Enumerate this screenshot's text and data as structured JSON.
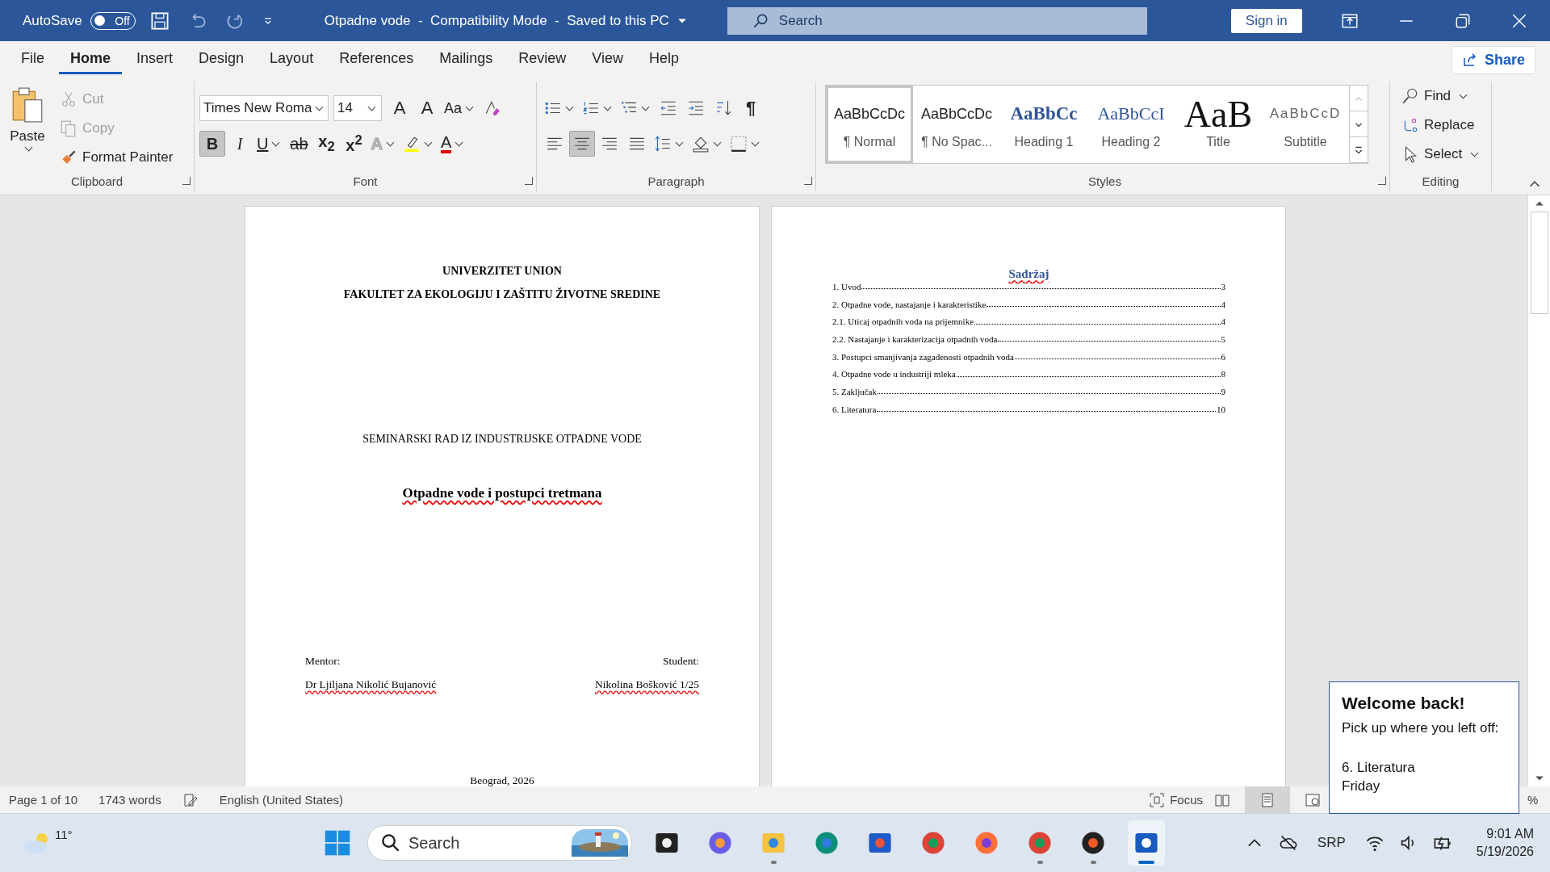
{
  "window": {
    "autosave_label": "AutoSave",
    "autosave": {
      "on": false,
      "label": "Off"
    },
    "title": "Otpadne vode  -  Compatibility Mode  -  Saved to this PC",
    "search_placeholder": "Search",
    "sign_in": "Sign in"
  },
  "menu_tabs": [
    {
      "label": "File",
      "selected": false
    },
    {
      "label": "Home",
      "selected": true
    },
    {
      "label": "Insert",
      "selected": false
    },
    {
      "label": "Design",
      "selected": false
    },
    {
      "label": "Layout",
      "selected": false
    },
    {
      "label": "References",
      "selected": false
    },
    {
      "label": "Mailings",
      "selected": false
    },
    {
      "label": "Review",
      "selected": false
    },
    {
      "label": "View",
      "selected": false
    },
    {
      "label": "Help",
      "selected": false
    }
  ],
  "share": "Share",
  "clipboard": {
    "title": "Clipboard",
    "paste": "Paste",
    "items": [
      {
        "kind": "cut",
        "label": "Cut",
        "disabled": true
      },
      {
        "kind": "copy",
        "label": "Copy",
        "disabled": true
      },
      {
        "kind": "painter",
        "label": "Format Painter",
        "disabled": false
      }
    ]
  },
  "font": {
    "title": "Font",
    "name": "Times New Roma",
    "size": "14",
    "row1": [
      {
        "kind": "grow",
        "label": "A"
      },
      {
        "kind": "shrink",
        "label": "A"
      },
      {
        "kind": "case",
        "label": "Aa"
      },
      {
        "kind": "clear"
      }
    ],
    "row2": [
      {
        "kind": "bold",
        "label": "B",
        "selected": true
      },
      {
        "kind": "italic",
        "label": "I",
        "selected": false
      },
      {
        "kind": "underline",
        "label": "U",
        "selected": false
      },
      {
        "kind": "strike",
        "label": "ab",
        "selected": false
      },
      {
        "kind": "sub",
        "label": "x$_{2}$",
        "selected": false
      },
      {
        "kind": "sup",
        "label": "x$^{2}$",
        "selected": false
      },
      {
        "kind": "effects",
        "label": "A",
        "selected": false
      },
      {
        "kind": "highlight",
        "selected": false
      },
      {
        "kind": "color",
        "label": "A",
        "selected": false
      }
    ]
  },
  "paragraph": {
    "title": "Paragraph",
    "row1": [
      {
        "kind": "bullets",
        "selected": false
      },
      {
        "kind": "numbering",
        "selected": false
      },
      {
        "kind": "multilevel",
        "selected": false
      },
      {
        "kind": "outdent",
        "selected": false
      },
      {
        "kind": "indent",
        "selected": false
      },
      {
        "kind": "sort",
        "selected": false
      },
      {
        "kind": "marks",
        "label": "¶",
        "selected": false
      }
    ],
    "row2": [
      {
        "kind": "align-left",
        "selected": false
      },
      {
        "kind": "align-center",
        "selected": true
      },
      {
        "kind": "align-right",
        "selected": false
      },
      {
        "kind": "justify",
        "selected": false
      },
      {
        "kind": "spacing",
        "selected": false
      },
      {
        "kind": "shading",
        "selected": false
      },
      {
        "kind": "borders",
        "selected": false
      }
    ]
  },
  "styles": {
    "title": "Styles",
    "items": [
      {
        "kind": "normal",
        "preview": "AaBbCcDc",
        "name": "¶ Normal",
        "selected": true
      },
      {
        "kind": "nospacing",
        "preview": "AaBbCcDc",
        "name": "¶ No Spac...",
        "selected": false
      },
      {
        "kind": "heading1",
        "preview": "AaBbCc",
        "name": "Heading 1",
        "selected": false
      },
      {
        "kind": "heading2",
        "preview": "AaBbCcI",
        "name": "Heading 2",
        "selected": false
      },
      {
        "kind": "title",
        "preview": "AaB",
        "name": "Title",
        "selected": false
      },
      {
        "kind": "subtitle",
        "preview": "AaBbCcD",
        "name": "Subtitle",
        "selected": false
      }
    ]
  },
  "editing": {
    "title": "Editing",
    "items": [
      {
        "kind": "find",
        "label": "Find"
      },
      {
        "kind": "replace",
        "label": "Replace"
      },
      {
        "kind": "select",
        "label": "Select"
      }
    ]
  },
  "page1": {
    "header": [
      "UNIVERZITET UNION",
      "FAKULTET ZA EKOLOGIJU I ZAŠTITU ŽIVOTNE SREDINE"
    ],
    "subject": "SEMINARSKI RAD IZ INDUSTRIJSKE OTPADNE VODE",
    "title": "Otpadne vode i postupci tretmana",
    "left_label": "Mentor:",
    "right_label": "Student:",
    "left_name": "Dr Ljiljana Nikolić Bujanović",
    "right_name": "Nikolina Bošković 1/25",
    "footer": "Beograd, 2026"
  },
  "page2": {
    "toc_title": "Sadržaj",
    "toc": [
      {
        "text": "1. Uvod",
        "page": "3"
      },
      {
        "text": "2. Otpadne vode, nastajanje i karakteristike",
        "page": "4"
      },
      {
        "text": "2.1. Uticaj otpadnih voda na prijemnike",
        "page": "4"
      },
      {
        "text": "2.2. Nastajanje i karakterizacija otpadnih voda",
        "page": "5"
      },
      {
        "text": "3. Postupci smanjivanja zagađenosti otpadnih voda",
        "page": "6"
      },
      {
        "text": "4. Otpadne vode u industriji mleka",
        "page": "8"
      },
      {
        "text": "5.  Zaključak",
        "page": "9"
      },
      {
        "text": "6. Literatura",
        "page": "10"
      }
    ]
  },
  "status_bar": {
    "page": "Page 1 of 10",
    "words": "1743 words",
    "language": "English (United States)",
    "focus": "Focus",
    "views": [
      {
        "kind": "read",
        "selected": false
      },
      {
        "kind": "print",
        "selected": true
      },
      {
        "kind": "web",
        "selected": false
      }
    ],
    "zoom": "%"
  },
  "notification": {
    "title": "Welcome back!",
    "text": "Pick up where you left off:",
    "item": "6. Literatura",
    "day": "Friday"
  },
  "taskbar": {
    "weather": "11°",
    "search_placeholder": "Search",
    "apps": [
      {
        "kind": "taskview",
        "running": false,
        "selected": false
      },
      {
        "kind": "copilot",
        "running": false,
        "selected": false
      },
      {
        "kind": "explorer",
        "running": true,
        "selected": false
      },
      {
        "kind": "edge",
        "running": false,
        "selected": false
      },
      {
        "kind": "store",
        "running": false,
        "selected": false
      },
      {
        "kind": "chrome",
        "running": false,
        "selected": false
      },
      {
        "kind": "firefox",
        "running": false,
        "selected": false
      },
      {
        "kind": "chrome",
        "running": true,
        "selected": false
      },
      {
        "kind": "media",
        "running": true,
        "selected": false
      },
      {
        "kind": "word",
        "running": true,
        "selected": true
      }
    ],
    "language": "SRP",
    "time": "9:01 AM",
    "date": "5/19/2026"
  }
}
